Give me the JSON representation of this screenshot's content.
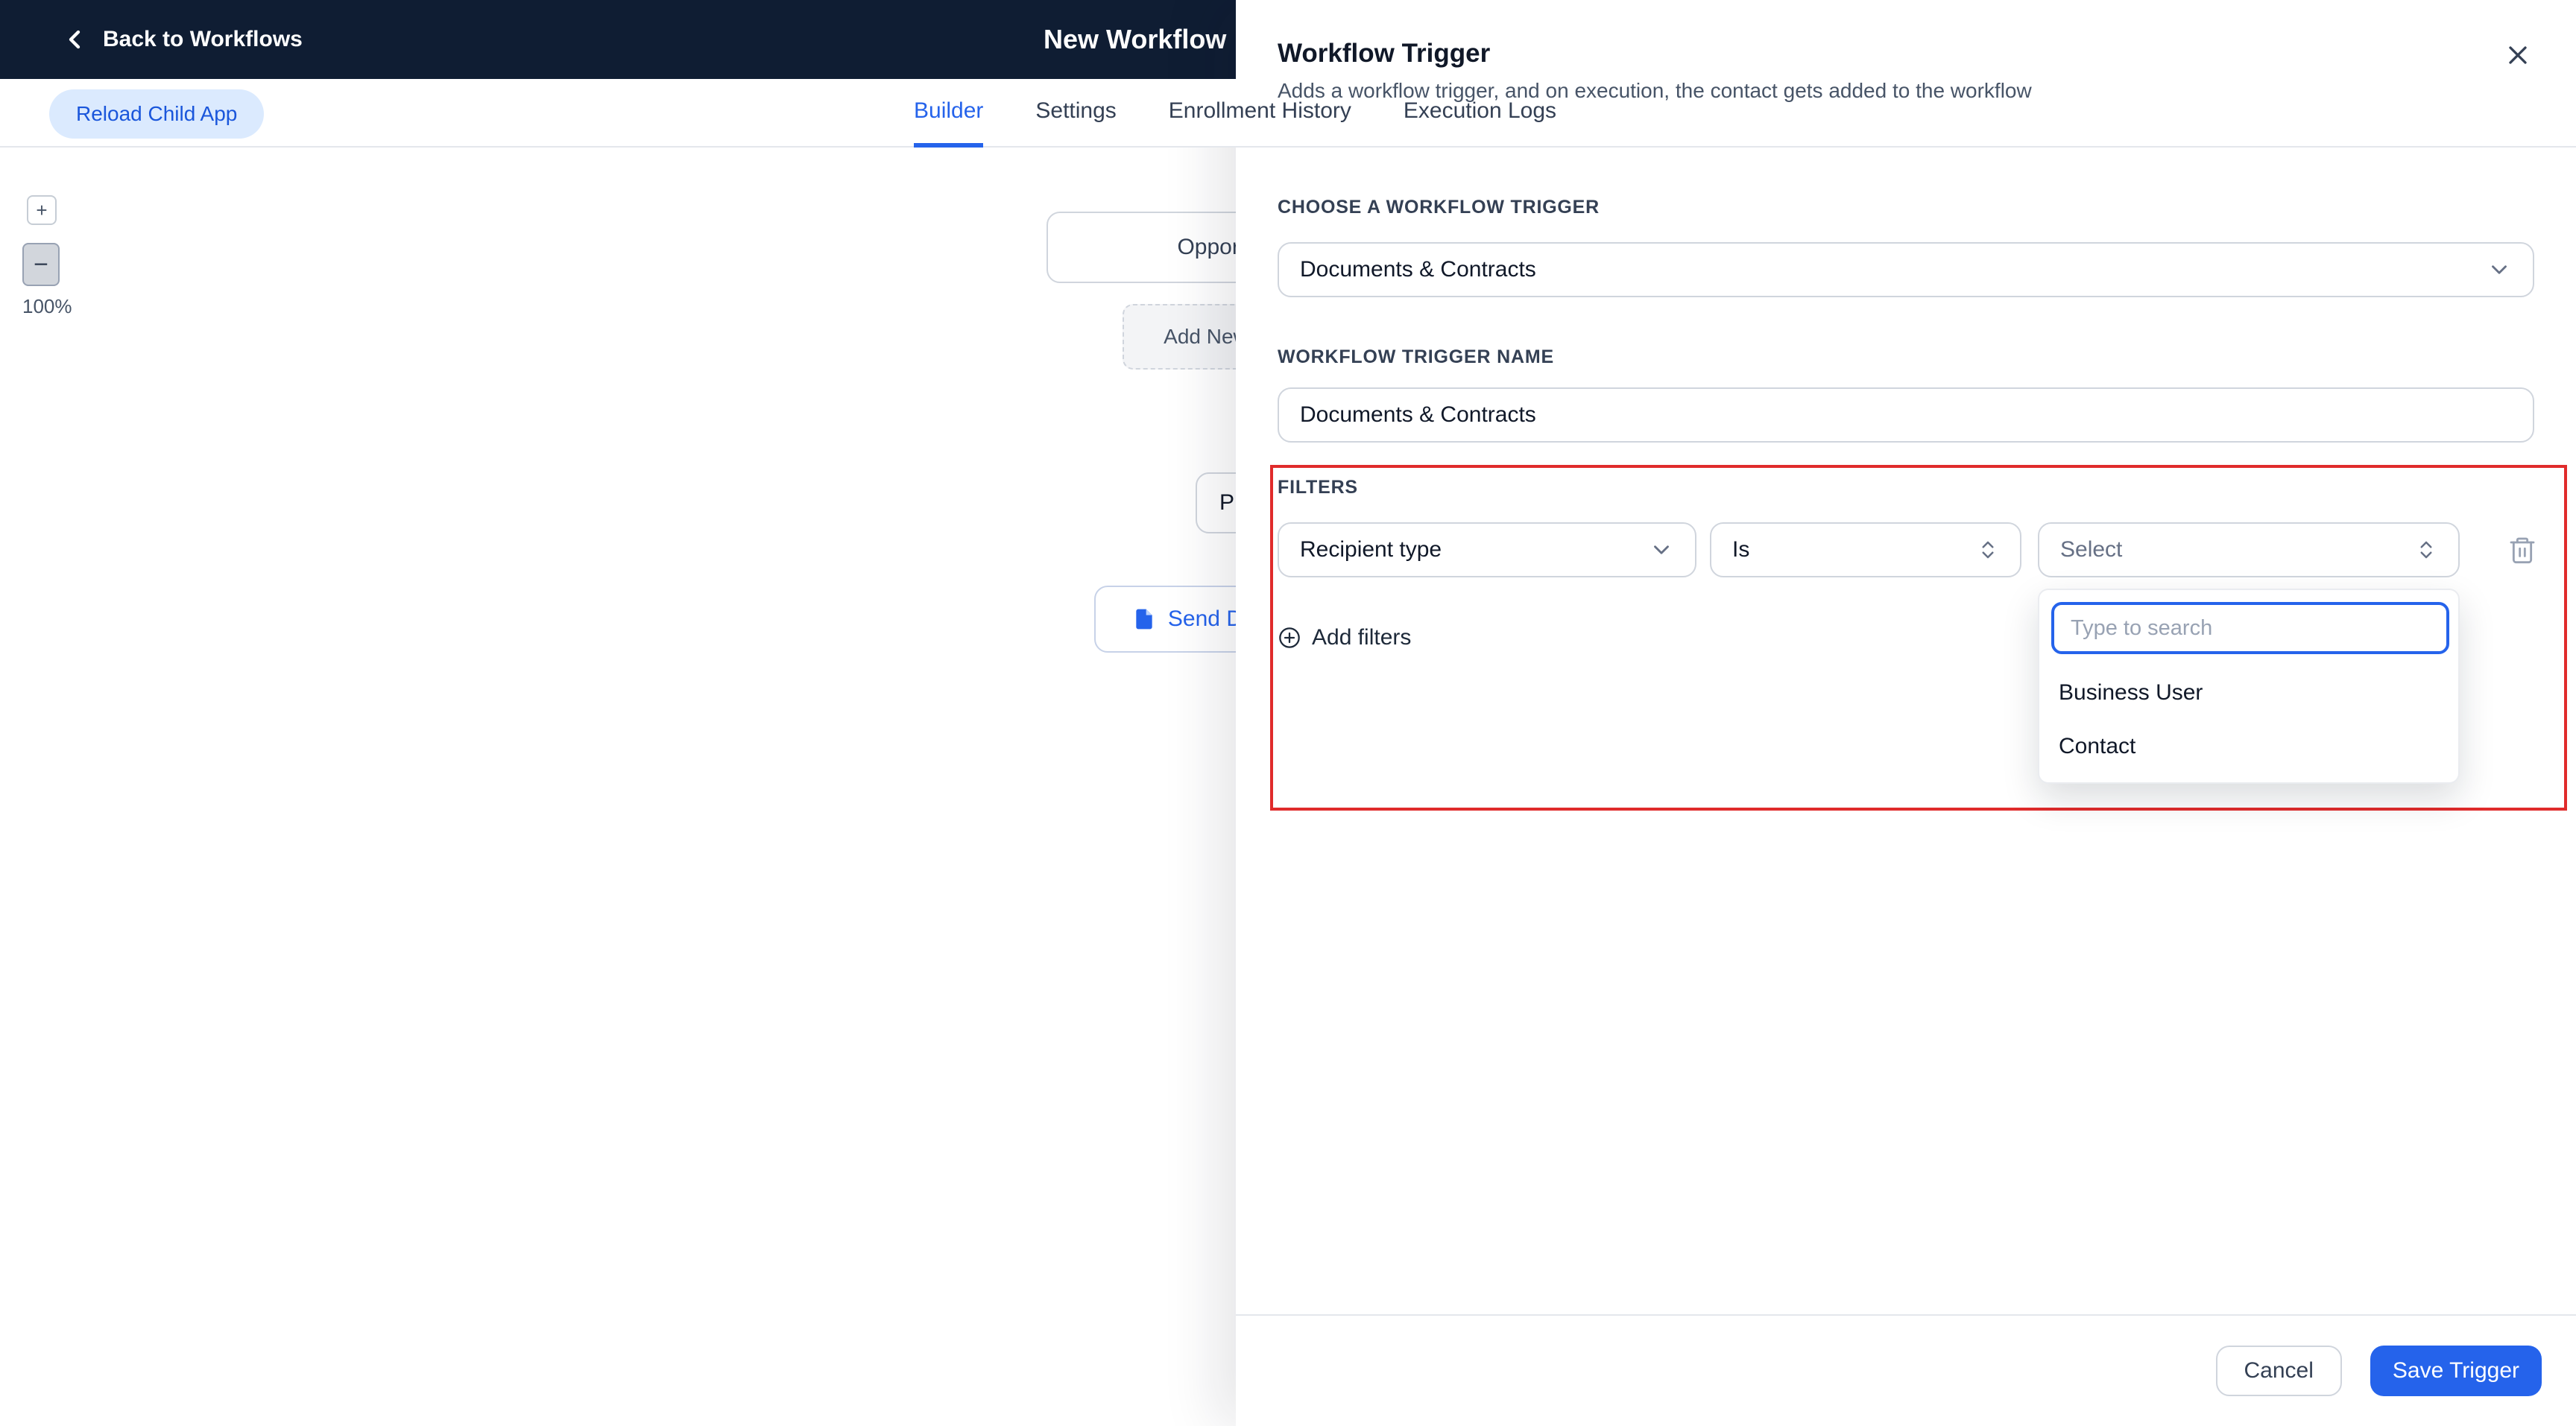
{
  "topbar": {
    "back_label": "Back to Workflows",
    "title": "New Workflow"
  },
  "subheader": {
    "reload_button": "Reload Child App"
  },
  "tabs": [
    {
      "label": "Builder"
    },
    {
      "label": "Settings"
    },
    {
      "label": "Enrollment History"
    },
    {
      "label": "Execution Logs"
    }
  ],
  "canvas": {
    "zoom_in": "+",
    "zoom_out": "−",
    "zoom_level": "100%",
    "nodes": {
      "trigger": "Opportunity",
      "add_new": "Add New Action",
      "notice": "Please add a trigger",
      "send": "Send Documents"
    }
  },
  "panel": {
    "title": "Workflow Trigger",
    "subtitle": "Adds a workflow trigger, and on execution, the contact gets added to the workflow",
    "choose_trigger_label": "CHOOSE A WORKFLOW TRIGGER",
    "trigger_select_value": "Documents & Contracts",
    "trigger_name_label": "WORKFLOW TRIGGER NAME",
    "trigger_name_value": "Documents & Contracts",
    "filters": {
      "section_label": "FILTERS",
      "field_value": "Recipient type",
      "operator_value": "Is",
      "value_placeholder": "Select",
      "search_placeholder": "Type to search",
      "options": [
        {
          "label": "Business User"
        },
        {
          "label": "Contact"
        }
      ],
      "add_filters_label": "Add filters"
    },
    "footer": {
      "cancel_label": "Cancel",
      "save_label": "Save Trigger"
    }
  },
  "colors": {
    "topbar_bg": "#0f1d33",
    "primary_blue": "#2563eb",
    "reload_bg": "#dbeafe",
    "reload_text": "#1a56db",
    "highlight_red": "#e02b2b",
    "border_gray": "#d0d5dd",
    "text_dark": "#101828",
    "text_muted": "#475467"
  }
}
